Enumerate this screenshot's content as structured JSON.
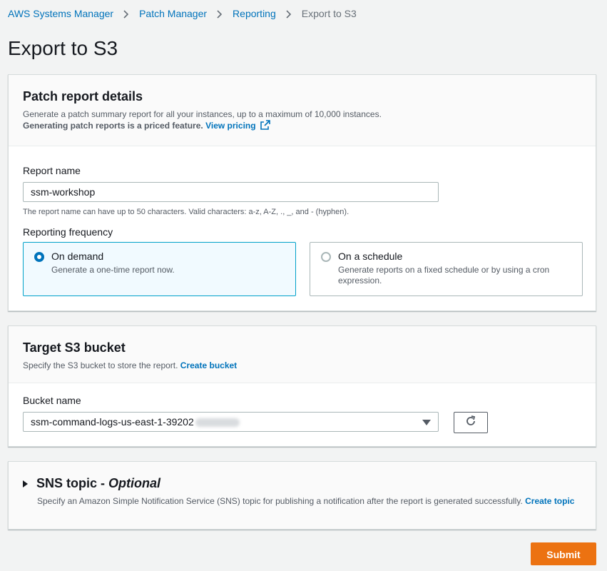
{
  "breadcrumb": {
    "items": [
      "AWS Systems Manager",
      "Patch Manager",
      "Reporting"
    ],
    "current": "Export to S3"
  },
  "page_title": "Export to S3",
  "patch_report": {
    "title": "Patch report details",
    "description": "Generate a patch summary report for all your instances, up to a maximum of 10,000 instances.",
    "priced_note": "Generating patch reports is a priced feature.",
    "pricing_link": "View pricing",
    "report_name_label": "Report name",
    "report_name_value": "ssm-workshop",
    "report_name_constraint": "The report name can have up to 50 characters. Valid characters: a-z, A-Z, ., _, and - (hyphen).",
    "frequency_label": "Reporting frequency",
    "options": [
      {
        "title": "On demand",
        "description": "Generate a one-time report now.",
        "selected": true
      },
      {
        "title": "On a schedule",
        "description": "Generate reports on a fixed schedule or by using a cron expression.",
        "selected": false
      }
    ]
  },
  "target_bucket": {
    "title": "Target S3 bucket",
    "description": "Specify the S3 bucket to store the report.",
    "create_link": "Create bucket",
    "bucket_name_label": "Bucket name",
    "bucket_name_value": "ssm-command-logs-us-east-1-39202"
  },
  "sns": {
    "title": "SNS topic - ",
    "title_optional": "Optional",
    "description": "Specify an Amazon Simple Notification Service (SNS) topic for publishing a notification after the report is generated successfully.",
    "create_link": "Create topic"
  },
  "submit_label": "Submit",
  "colors": {
    "accent": "#0073bb",
    "primary_button": "#ec7211",
    "selected_card_bg": "#f1faff"
  }
}
